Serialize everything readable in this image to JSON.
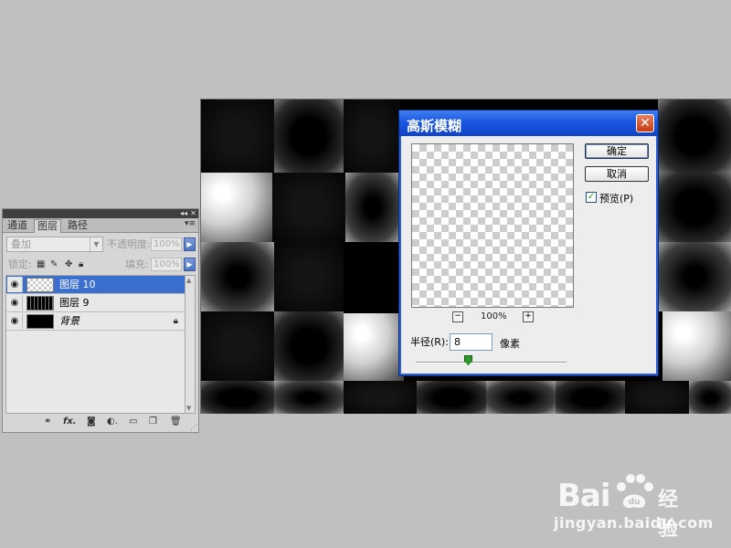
{
  "layers_panel": {
    "tabs": [
      "通道",
      "图层",
      "路径"
    ],
    "blend_mode": "叠加",
    "opacity_label": "不透明度:",
    "opacity_value": "100%",
    "lock_label": "锁定:",
    "fill_label": "填充:",
    "fill_value": "100%",
    "layers": [
      {
        "name": "图层 10",
        "selected": true,
        "visible": true,
        "thumbnail": "transparent-checker"
      },
      {
        "name": "图层 9",
        "selected": false,
        "visible": true,
        "thumbnail": "dark-pattern"
      },
      {
        "name": "背景",
        "selected": false,
        "visible": true,
        "thumbnail": "black",
        "locked": true
      }
    ],
    "bottom_icons": [
      "link-icon",
      "fx-icon",
      "mask-icon",
      "adjustment-icon",
      "group-icon",
      "new-layer-icon",
      "trash-icon"
    ]
  },
  "dialog": {
    "title": "高斯模糊",
    "ok_label": "确定",
    "cancel_label": "取消",
    "preview_label": "预览(P)",
    "preview_checked": true,
    "zoom_value": "100%",
    "radius_label": "半径(R):",
    "radius_value": "8",
    "radius_unit": "像素"
  },
  "watermark": {
    "brand": "Bai",
    "brand_suffix": "经验",
    "url": "jingyan.baidu.com"
  }
}
